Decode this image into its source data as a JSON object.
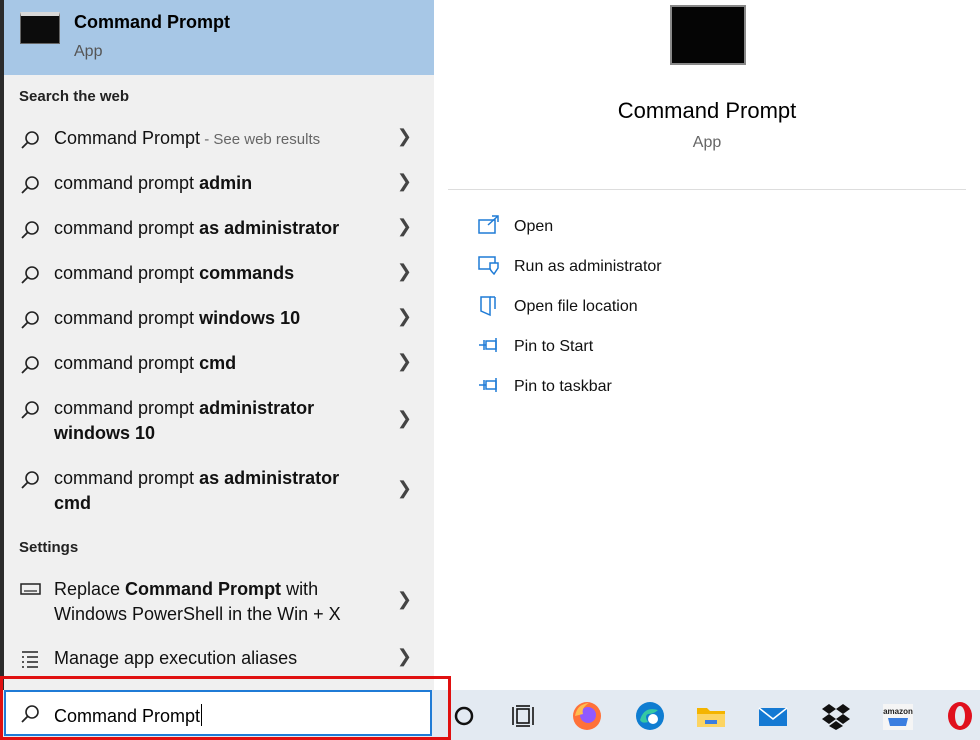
{
  "best_match": {
    "title": "Command Prompt",
    "subtitle": "App"
  },
  "web_section": {
    "label": "Search the web"
  },
  "web_results": [
    {
      "normal": "Command Prompt",
      "bold": "",
      "suffix": " - See web results"
    },
    {
      "normal": "command prompt ",
      "bold": "admin",
      "suffix": ""
    },
    {
      "normal": "command prompt ",
      "bold": "as administrator",
      "suffix": ""
    },
    {
      "normal": "command prompt ",
      "bold": "commands",
      "suffix": ""
    },
    {
      "normal": "command prompt ",
      "bold": "windows 10",
      "suffix": ""
    },
    {
      "normal": "command prompt ",
      "bold": "cmd",
      "suffix": ""
    },
    {
      "normal": "command prompt ",
      "bold": "administrator",
      "line2": "windows 10",
      "suffix": ""
    },
    {
      "normal": "command prompt ",
      "bold": "as administrator",
      "line2": "cmd",
      "suffix": ""
    }
  ],
  "settings_section": {
    "label": "Settings"
  },
  "settings_results": [
    {
      "pre": "Replace ",
      "bold": "Command Prompt",
      "post": " with",
      "line2": "Windows PowerShell in the Win + X"
    },
    {
      "pre": "Manage app execution aliases",
      "bold": "",
      "post": "",
      "line2": ""
    }
  ],
  "preview": {
    "title": "Command Prompt",
    "subtitle": "App"
  },
  "actions": [
    {
      "label": "Open",
      "icon": "open-icon"
    },
    {
      "label": "Run as administrator",
      "icon": "shield-icon"
    },
    {
      "label": "Open file location",
      "icon": "folder-location-icon"
    },
    {
      "label": "Pin to Start",
      "icon": "pin-icon"
    },
    {
      "label": "Pin to taskbar",
      "icon": "pin-icon"
    }
  ],
  "search": {
    "value": "Command Prompt"
  },
  "taskbar": [
    "cortana-icon",
    "task-view-icon",
    "firefox-icon",
    "edge-icon",
    "file-explorer-icon",
    "mail-icon",
    "dropbox-icon",
    "amazon-icon",
    "opera-icon"
  ],
  "taskbar_labels": {
    "amazon": "amazon"
  },
  "colors": {
    "accent": "#1f7bd6",
    "selected": "#a7c7e6",
    "highlight": "#e01010"
  }
}
